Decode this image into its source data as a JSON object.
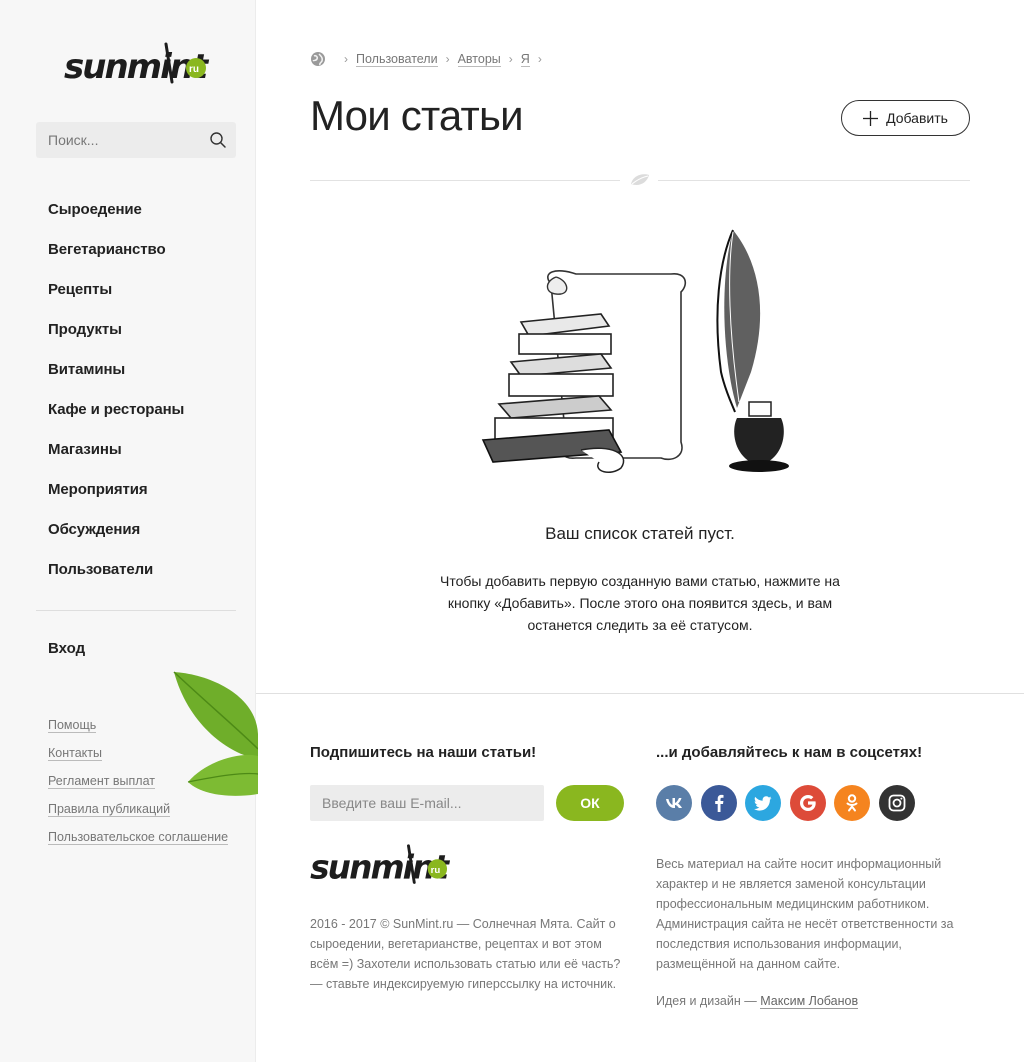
{
  "brand": {
    "logo_text": "sunmint",
    "logo_badge": "ru"
  },
  "search": {
    "placeholder": "Поиск..."
  },
  "sidebar": {
    "nav": [
      {
        "label": "Сыроедение"
      },
      {
        "label": "Вегетарианство"
      },
      {
        "label": "Рецепты"
      },
      {
        "label": "Продукты"
      },
      {
        "label": "Витамины"
      },
      {
        "label": "Кафе и рестораны"
      },
      {
        "label": "Магазины"
      },
      {
        "label": "Мероприятия"
      },
      {
        "label": "Обсуждения"
      },
      {
        "label": "Пользователи"
      }
    ],
    "login": "Вход",
    "links": [
      {
        "label": "Помощь"
      },
      {
        "label": "Контакты"
      },
      {
        "label": "Регламент выплат"
      },
      {
        "label": "Правила публикаций"
      },
      {
        "label": "Пользовательское соглашение"
      }
    ]
  },
  "breadcrumb": {
    "items": [
      "Пользователи",
      "Авторы",
      "Я"
    ]
  },
  "page": {
    "title": "Мои статьи",
    "add_label": "Добавить",
    "empty_title": "Ваш список статей пуст.",
    "empty_text": "Чтобы добавить первую созданную вами статью, нажмите на кнопку «Добавить». После этого она появится здесь, и вам останется следить за её статусом."
  },
  "footer": {
    "subscribe_title": "Подпишитесь на наши статьи!",
    "email_placeholder": "Введите ваш E-mail...",
    "ok_label": "ОК",
    "copyright": "2016 - 2017 © SunMint.ru — Солнечная Мята. Сайт о сыроедении, вегетарианстве, рецептах и вот этом всём =) Захотели использовать статью или её часть? — ставьте индексируемую гиперссылку на источник.",
    "social_title": "...и добавляйтесь к нам в соцсетях!",
    "social": [
      {
        "name": "vk-icon",
        "glyph": "вк",
        "color": "#5a7ea8"
      },
      {
        "name": "facebook-icon",
        "glyph": "f",
        "color": "#3b5998"
      },
      {
        "name": "twitter-icon",
        "glyph": "t",
        "color": "#2ca7e0"
      },
      {
        "name": "google-icon",
        "glyph": "G",
        "color": "#dd4b39"
      },
      {
        "name": "odnoklassniki-icon",
        "glyph": "ok",
        "color": "#f5841f"
      },
      {
        "name": "instagram-icon",
        "glyph": "ig",
        "color": "#333333"
      }
    ],
    "disclaimer": "Весь материал на сайте носит информационный характер и не является заменой консультации профессиональным медицинским работником. Администрация сайта не несёт ответственности за последствия использования информации, размещённой на данном сайте.",
    "credits_prefix": "Идея и дизайн —",
    "credits_author": "Максим Лобанов"
  },
  "colors": {
    "accent": "#8ab71f",
    "text": "#222222",
    "muted": "#777777"
  }
}
